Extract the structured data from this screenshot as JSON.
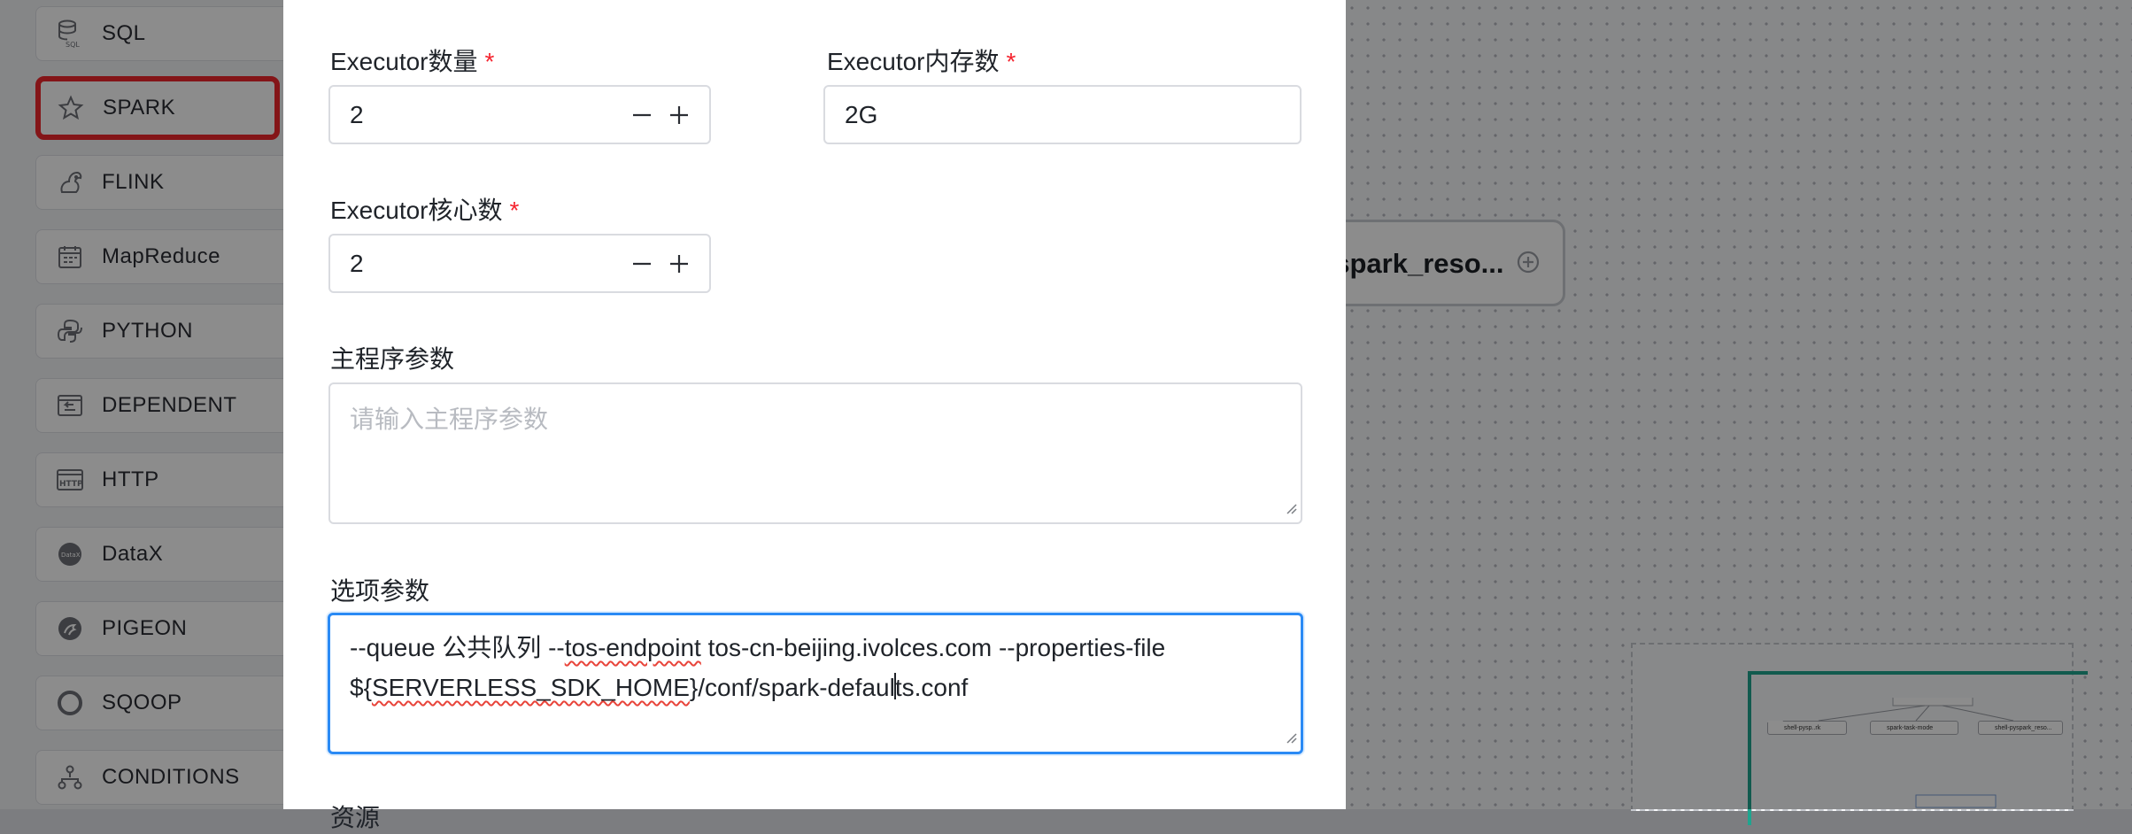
{
  "sidebar": {
    "items": [
      {
        "label": "SQL",
        "icon": "database-icon"
      },
      {
        "label": "SPARK",
        "icon": "star-icon",
        "active": true
      },
      {
        "label": "FLINK",
        "icon": "squirrel-icon"
      },
      {
        "label": "MapReduce",
        "icon": "calendar-icon"
      },
      {
        "label": "PYTHON",
        "icon": "python-icon"
      },
      {
        "label": "DEPENDENT",
        "icon": "dependent-icon"
      },
      {
        "label": "HTTP",
        "icon": "http-icon"
      },
      {
        "label": "DataX",
        "icon": "datax-icon"
      },
      {
        "label": "PIGEON",
        "icon": "pigeon-icon"
      },
      {
        "label": "SQOOP",
        "icon": "sqoop-icon"
      },
      {
        "label": "CONDITIONS",
        "icon": "conditions-icon"
      }
    ]
  },
  "canvas": {
    "node_label": "yspark_reso...",
    "minimap_nodes": [
      "shell-pysp..rk",
      "spark-task-mode",
      "shell-pyspark_reso..."
    ]
  },
  "form": {
    "executor_count": {
      "label": "Executor数量",
      "required_mark": "*",
      "value": "2"
    },
    "executor_memory": {
      "label": "Executor内存数",
      "required_mark": "*",
      "value": "2G"
    },
    "executor_cores": {
      "label": "Executor核心数",
      "required_mark": "*",
      "value": "2"
    },
    "main_args": {
      "label": "主程序参数",
      "placeholder": "请输入主程序参数"
    },
    "option_args": {
      "label": "选项参数",
      "line1_a": "--queue 公共队列 --",
      "line1_b": "tos-endpoint",
      "line1_c": " tos-cn-beijing.ivolces.com --properties-file",
      "line2_a": "${",
      "line2_b": "SERVERLESS_SDK_HOME",
      "line2_c": "}/conf/spark-defaul",
      "line2_d": "ts.conf"
    },
    "next_label_partial": "资源"
  },
  "colors": {
    "required": "#f5222d",
    "focus": "#2a8af5",
    "highlight": "#f0272c",
    "minimap_frame": "#1fa58f"
  }
}
